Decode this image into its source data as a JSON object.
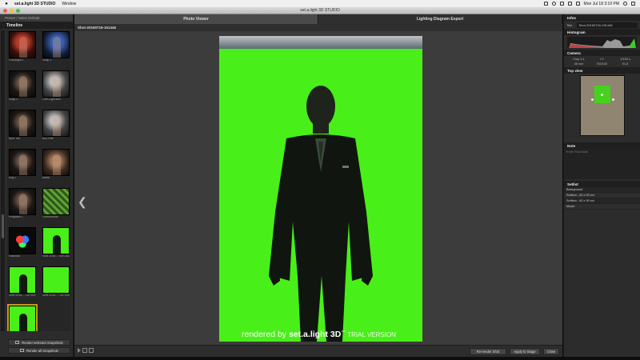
{
  "menubar": {
    "apple": "",
    "app_name": "set.a.light 3D STUDIO",
    "menu_window": "Window",
    "clock": "Mon Jul 18  3:10 PM"
  },
  "window": {
    "title": "set.a.light 3D STUDIO"
  },
  "left": {
    "project_title": "Preset / Selex Default",
    "timeline_header": "Timeline",
    "thumbnails": [
      {
        "label": "Floodlight 1",
        "kind": "portrait-red"
      },
      {
        "label": "Snap 1",
        "kind": "portrait-blue"
      },
      {
        "label": "Snap 2",
        "kind": "portrait-dark"
      },
      {
        "label": "One-Light-BW",
        "kind": "portrait-bw"
      },
      {
        "label": "Beer Set",
        "kind": "portrait-dark"
      },
      {
        "label": "BW-Plan",
        "kind": "portrait-bw"
      },
      {
        "label": "Edg 1",
        "kind": "portrait-dark"
      },
      {
        "label": "Beast",
        "kind": "portrait-warm"
      },
      {
        "label": "Pregnant 1",
        "kind": "portrait-dark"
      },
      {
        "label": "Greenhouse",
        "kind": "foliage"
      },
      {
        "label": "Rainbow",
        "kind": "rgb"
      },
      {
        "label": "Shot 2016 ...Tue 1483B",
        "kind": "green-person"
      },
      {
        "label": "Shot 2016 ...716 100733",
        "kind": "green-person"
      },
      {
        "label": "Shot 2016 ...716 105030",
        "kind": "green-plain"
      },
      {
        "label": "Shot 2016 ...716 151446",
        "kind": "green-person",
        "selected": true
      }
    ],
    "render_selected_label": "Render selected Snapshots",
    "render_all_label": "Render all Snapshots"
  },
  "center": {
    "tabs": [
      {
        "label": "Photo Viewer",
        "active": true
      },
      {
        "label": "Lighting Diagram Export",
        "active": false
      }
    ],
    "shot_name": "Shot-20160716-151446",
    "watermark": {
      "rendered_by": "rendered by",
      "brand": "set.a.light 3D",
      "tm": "™",
      "trial": "TRIAL VERSION"
    },
    "buttons": {
      "rerender": "Re-render Shot",
      "apply": "Apply to Stage",
      "close": "Close"
    },
    "colors": {
      "background_green": "#49ef18",
      "accent_selected": "#c89a1c"
    }
  },
  "right": {
    "info_header": "Infos",
    "title_label": "Title:",
    "title_value": "Shot-20160716-151446",
    "histogram_header": "Histogram",
    "camera_header": "Camera",
    "camera": [
      "Crop 1:1",
      "f 2",
      "1/125 s",
      "35 mm",
      "ISO100",
      "f/1.8"
    ],
    "topview_header": "Top view",
    "note_header": "Note",
    "note_placeholder": "Enter Shot Note",
    "setlist_header": "Setlist",
    "setlist": [
      "Background",
      "Softbox - 60 x 90 cm",
      "Softbox - 60 x 90 cm",
      "Model"
    ]
  }
}
